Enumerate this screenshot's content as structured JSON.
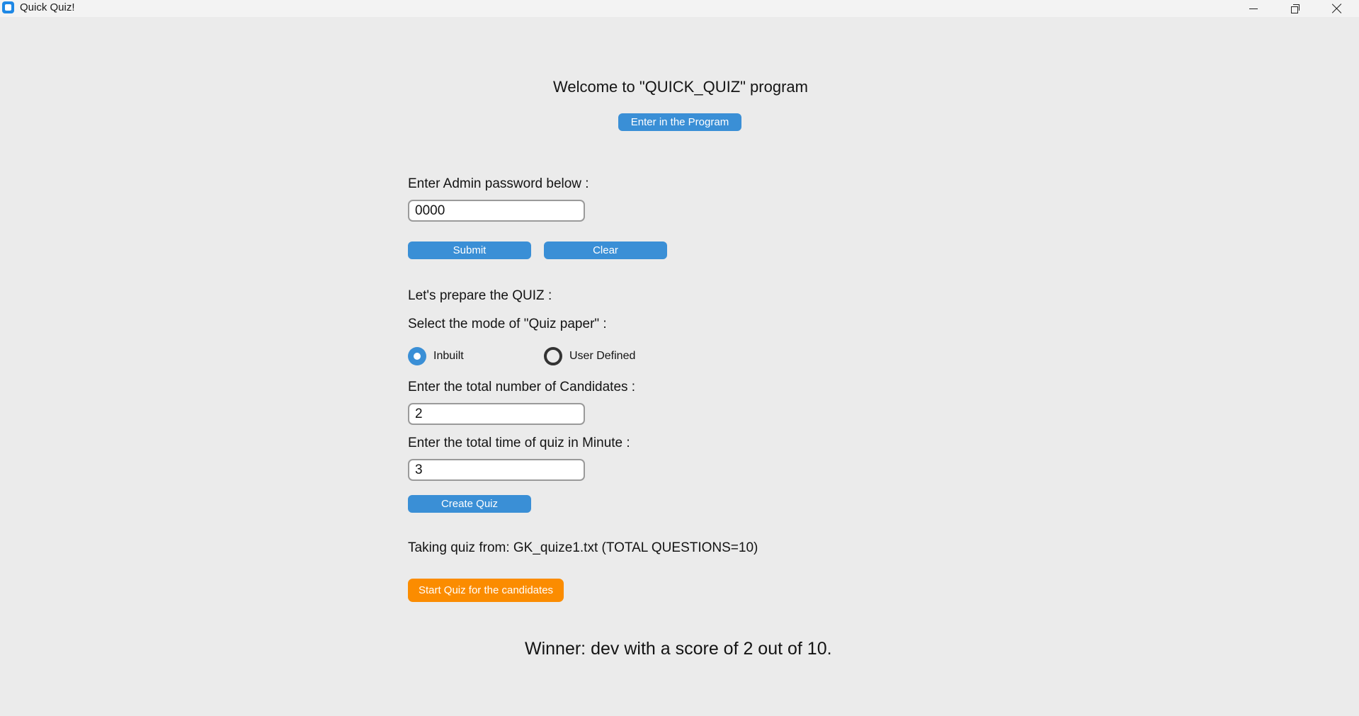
{
  "window": {
    "title": "Quick Quiz!"
  },
  "header": {
    "welcome": "Welcome to \"QUICK_QUIZ\" program",
    "enter_button": "Enter in the Program"
  },
  "admin": {
    "password_label": "Enter Admin password below :",
    "password_value": "0000",
    "submit_label": "Submit",
    "clear_label": "Clear"
  },
  "prepare": {
    "heading": "Let's prepare the QUIZ :",
    "mode_label": "Select the mode of \"Quiz paper\" :",
    "modes": [
      {
        "label": "Inbuilt",
        "selected": true
      },
      {
        "label": "User Defined",
        "selected": false
      }
    ],
    "candidates_label": "Enter the total number of Candidates :",
    "candidates_value": "2",
    "time_label": "Enter the total time of quiz in Minute :",
    "time_value": "3",
    "create_label": "Create Quiz"
  },
  "quiz": {
    "source_text": "Taking quiz from: GK_quize1.txt (TOTAL QUESTIONS=10)",
    "start_label": "Start Quiz for the candidates"
  },
  "result": {
    "winner_text": "Winner: dev with a score of 2 out of 10."
  },
  "colors": {
    "primary_button": "#3a8fd6",
    "start_button": "#fb8c00",
    "background": "#ebebeb"
  }
}
